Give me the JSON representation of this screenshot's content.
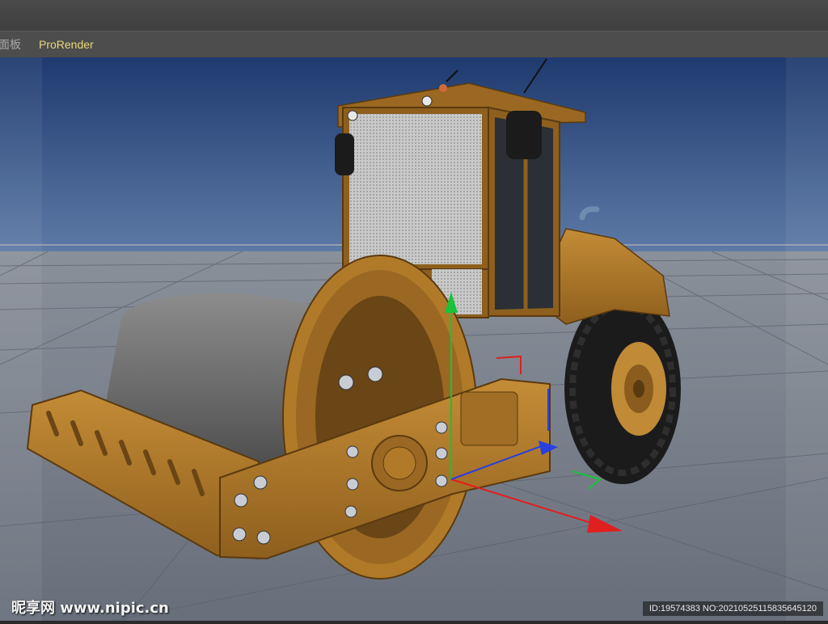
{
  "menu": {
    "items": [
      {
        "label": "面板"
      },
      {
        "label": "ProRender"
      }
    ]
  },
  "viewport": {
    "axis_icons": {
      "y_axis": "y-axis-arrow-green",
      "x_axis": "x-axis-arrow-red",
      "z_axis": "z-axis-arrow-blue"
    },
    "colors": {
      "sky_top": "#1f3a70",
      "sky_bottom": "#5a78a6",
      "floor": "#727a86",
      "machine_body": "#b07a28",
      "axis_y": "#19c23a",
      "axis_x": "#e01f1f",
      "axis_z": "#2a3fe0"
    }
  },
  "watermark": {
    "left": "昵享网 www.nipic.cn",
    "right": "ID:19574383 NO:20210525115835645120"
  }
}
